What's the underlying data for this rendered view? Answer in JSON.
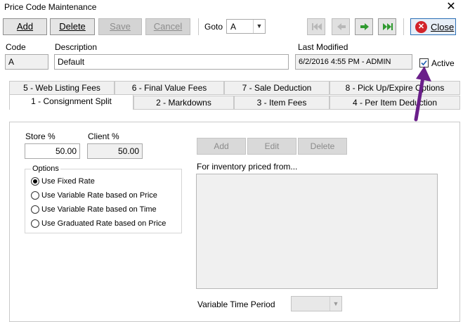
{
  "window": {
    "title": "Price Code Maintenance"
  },
  "toolbar": {
    "add_label": "Add",
    "delete_label": "Delete",
    "save_label": "Save",
    "cancel_label": "Cancel",
    "goto_label": "Goto",
    "goto_value": "A",
    "close_label": "Close"
  },
  "header": {
    "code_label": "Code",
    "code_value": "A",
    "description_label": "Description",
    "description_value": "Default",
    "last_modified_label": "Last Modified",
    "last_modified_value": "6/2/2016 4:55 PM - ADMIN",
    "active_label": "Active",
    "active_checked": true
  },
  "tabs": {
    "row1": [
      {
        "label": "5 - Web Listing Fees"
      },
      {
        "label": "6 - Final Value Fees"
      },
      {
        "label": "7 - Sale Deduction"
      },
      {
        "label": "8 - Pick Up/Expire Options"
      }
    ],
    "row2": [
      {
        "label": "1 - Consignment Split",
        "active": true
      },
      {
        "label": "2 - Markdowns"
      },
      {
        "label": "3 - Item Fees"
      },
      {
        "label": "4 - Per Item Deduction"
      }
    ]
  },
  "split": {
    "store_label": "Store %",
    "store_value": "50.00",
    "client_label": "Client %",
    "client_value": "50.00",
    "options_label": "Options",
    "options": [
      {
        "label": "Use Fixed Rate",
        "selected": true
      },
      {
        "label": "Use Variable Rate based on Price",
        "selected": false
      },
      {
        "label": "Use Variable Rate based on Time",
        "selected": false
      },
      {
        "label": "Use Graduated Rate based on Price",
        "selected": false
      }
    ]
  },
  "rates": {
    "add_label": "Add",
    "edit_label": "Edit",
    "delete_label": "Delete",
    "list_caption": "For inventory priced from...",
    "variable_time_period_label": "Variable Time Period",
    "variable_time_period_value": ""
  },
  "icons": {
    "first": "skip-first-icon",
    "prev": "arrow-left-icon",
    "next": "arrow-right-icon",
    "last": "skip-last-icon",
    "close": "close-circle-icon",
    "annotation": "purple-arrow-icon"
  },
  "colors": {
    "accent_close": "#d2232a",
    "nav_green": "#2f9a2f",
    "annotation_arrow": "#6a1f8a",
    "checkbox_check": "#1f5fb0"
  }
}
